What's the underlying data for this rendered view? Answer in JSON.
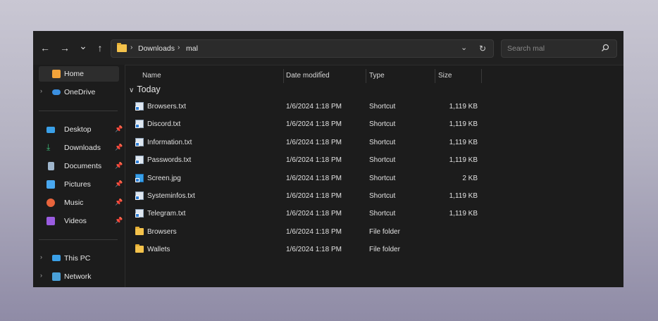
{
  "toolbar": {
    "back": "←",
    "forward": "→",
    "recent": "⌄",
    "up": "↑",
    "breadcrumb": [
      {
        "label": "Downloads"
      },
      {
        "label": "mal"
      }
    ],
    "crumb_sep": "›",
    "dropdown": "⌄",
    "refresh": "↻",
    "search_placeholder": "Search mal"
  },
  "sidebar": {
    "top": [
      {
        "label": "Home",
        "icon": "home-icon",
        "color": "#f2a33a",
        "selected": true
      },
      {
        "label": "OneDrive",
        "icon": "cloud-icon",
        "color": "#3b8fe0",
        "expandable": true
      }
    ],
    "pinned": [
      {
        "label": "Desktop",
        "icon": "desktop-icon",
        "color": "#3aa0e8"
      },
      {
        "label": "Downloads",
        "icon": "download-icon",
        "color": "#3cc07a"
      },
      {
        "label": "Documents",
        "icon": "document-icon",
        "color": "#9fb6cc"
      },
      {
        "label": "Pictures",
        "icon": "pictures-icon",
        "color": "#49a8f0"
      },
      {
        "label": "Music",
        "icon": "music-icon",
        "color": "#e8643c"
      },
      {
        "label": "Videos",
        "icon": "videos-icon",
        "color": "#9a5ce0"
      }
    ],
    "bottom": [
      {
        "label": "This PC",
        "icon": "computer-icon",
        "color": "#3aa0e8",
        "expandable": true
      },
      {
        "label": "Network",
        "icon": "network-icon",
        "color": "#4aa0d8",
        "expandable": true
      }
    ]
  },
  "columns": {
    "name": "Name",
    "date": "Date modified",
    "type": "Type",
    "size": "Size"
  },
  "group": {
    "label": "Today",
    "chevron": "∨"
  },
  "files": [
    {
      "name": "Browsers.txt",
      "date": "1/6/2024 1:18 PM",
      "type": "Shortcut",
      "size": "1,119 KB",
      "kind": "txt"
    },
    {
      "name": "Discord.txt",
      "date": "1/6/2024 1:18 PM",
      "type": "Shortcut",
      "size": "1,119 KB",
      "kind": "txt"
    },
    {
      "name": "Information.txt",
      "date": "1/6/2024 1:18 PM",
      "type": "Shortcut",
      "size": "1,119 KB",
      "kind": "txt"
    },
    {
      "name": "Passwords.txt",
      "date": "1/6/2024 1:18 PM",
      "type": "Shortcut",
      "size": "1,119 KB",
      "kind": "txt"
    },
    {
      "name": "Screen.jpg",
      "date": "1/6/2024 1:18 PM",
      "type": "Shortcut",
      "size": "2 KB",
      "kind": "img"
    },
    {
      "name": "Systeminfos.txt",
      "date": "1/6/2024 1:18 PM",
      "type": "Shortcut",
      "size": "1,119 KB",
      "kind": "txt"
    },
    {
      "name": "Telegram.txt",
      "date": "1/6/2024 1:18 PM",
      "type": "Shortcut",
      "size": "1,119 KB",
      "kind": "txt"
    },
    {
      "name": "Browsers",
      "date": "1/6/2024 1:18 PM",
      "type": "File folder",
      "size": "",
      "kind": "folder"
    },
    {
      "name": "Wallets",
      "date": "1/6/2024 1:18 PM",
      "type": "File folder",
      "size": "",
      "kind": "folder"
    }
  ]
}
